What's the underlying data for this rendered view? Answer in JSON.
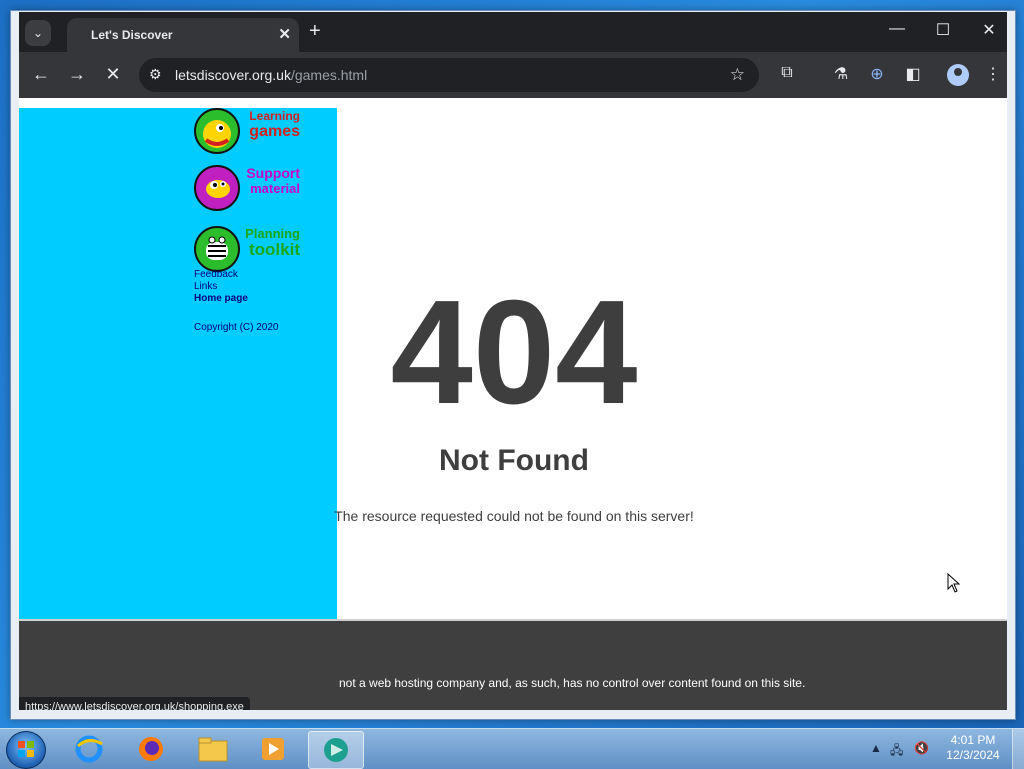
{
  "browser": {
    "tab_title": "Let's Discover",
    "url_host": "letsdiscover.org.uk",
    "url_path": "/games.html",
    "status_url": "https://www.letsdiscover.org.uk/shopping.exe"
  },
  "sidebar": {
    "items": [
      {
        "line1": "Learning",
        "line2": "games",
        "color": "#d42020",
        "icon": "dinosaur-icon"
      },
      {
        "line1": "Support",
        "line2": "material",
        "color": "#cc00cc",
        "icon": "giraffe-icon"
      },
      {
        "line1": "Planning",
        "line2": "toolkit",
        "color": "#1aa81a",
        "icon": "zebra-icon"
      }
    ],
    "links": [
      "Feedback",
      "Links",
      "Home page"
    ],
    "copyright": "Copyright (C) 2020"
  },
  "error": {
    "code": "404",
    "title": "Not Found",
    "message": "The resource requested could not be found on this server!"
  },
  "footer": {
    "text": "not a web hosting company and, as such, has no control over content found on this site."
  },
  "taskbar": {
    "time": "4:01 PM",
    "date": "12/3/2024"
  }
}
